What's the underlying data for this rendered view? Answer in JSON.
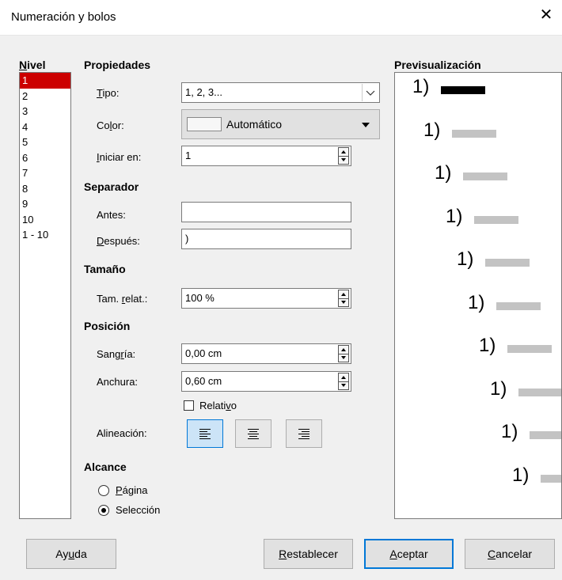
{
  "window": {
    "title": "Numeración y bolos",
    "close_glyph": "✕"
  },
  "level_panel": {
    "header": "Nivel",
    "items": [
      "1",
      "2",
      "3",
      "4",
      "5",
      "6",
      "7",
      "8",
      "9",
      "10",
      "1 - 10"
    ],
    "selected_index": 0
  },
  "properties": {
    "header": "Propiedades",
    "type_label": "Tipo:",
    "type_value": "1, 2, 3...",
    "color_label": "Color:",
    "color_value": "Automático",
    "start_label": "Iniciar en:",
    "start_value": "1"
  },
  "separator": {
    "header": "Separador",
    "before_label": "Antes:",
    "before_value": "",
    "after_label": "Después:",
    "after_value": ")"
  },
  "size": {
    "header": "Tamaño",
    "rel_label": "Tam. relat.:",
    "rel_value": "100 %"
  },
  "position": {
    "header": "Posición",
    "indent_label": "Sangría:",
    "indent_value": "0,00 cm",
    "width_label": "Anchura:",
    "width_value": "0,60 cm",
    "relative_label": "Relativo",
    "relative_checked": false,
    "align_label": "Alineación:",
    "align_selected": "left"
  },
  "scope": {
    "header": "Alcance",
    "page_label": "Página",
    "selection_label": "Selección",
    "selected": "selection"
  },
  "preview": {
    "header": "Previsualización",
    "number": "1)",
    "rows": 10
  },
  "buttons": {
    "help": "Ayuda",
    "reset": "Restablecer",
    "ok": "Aceptar",
    "cancel": "Cancelar"
  },
  "colors": {
    "selection": "#cc0000",
    "accent": "#0078d7",
    "preview_bar": "#c3c3c3"
  }
}
